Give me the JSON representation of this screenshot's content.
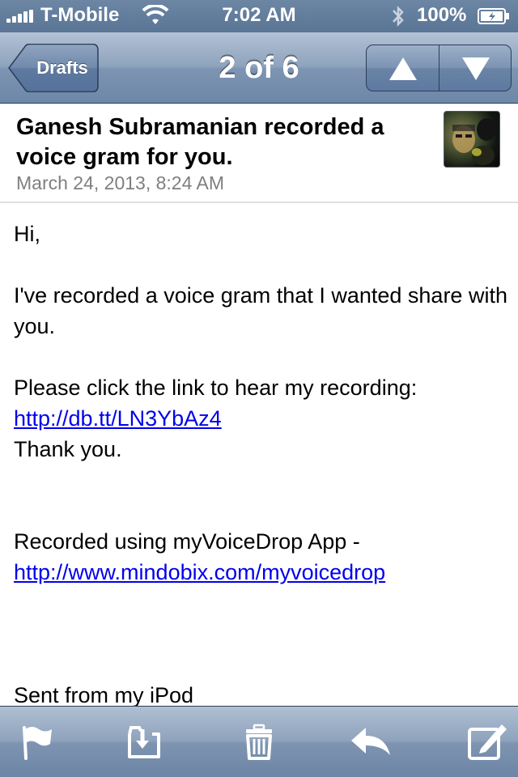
{
  "status_bar": {
    "carrier": "T-Mobile",
    "time": "7:02 AM",
    "battery": "100%",
    "icons": [
      "signal-icon",
      "wifi-icon",
      "bluetooth-icon",
      "battery-icon"
    ]
  },
  "nav": {
    "back_label": "Drafts",
    "position": "2 of 6",
    "prev_icon": "up-arrow-icon",
    "next_icon": "down-arrow-icon"
  },
  "message": {
    "subject": "Ganesh Subramanian recorded a voice gram for you.",
    "date": "March 24, 2013, 8:24 AM",
    "greeting": "Hi,",
    "line1": "I've recorded a voice gram that I wanted share with you.",
    "line2": "Please click the link to hear my recording:",
    "link1": "http://db.tt/LN3YbAz4",
    "thanks": "Thank you.",
    "recorded": "Recorded using myVoiceDrop App -",
    "link2": "http://www.mindobix.com/myvoicedrop",
    "signature": "Sent from my iPod"
  },
  "toolbar": {
    "icons": [
      "flag-icon",
      "move-to-folder-icon",
      "trash-icon",
      "reply-icon",
      "compose-icon"
    ]
  },
  "colors": {
    "bar_blue": "#6e87a8",
    "link": "#0000ee",
    "date_gray": "#7f7f7f"
  }
}
